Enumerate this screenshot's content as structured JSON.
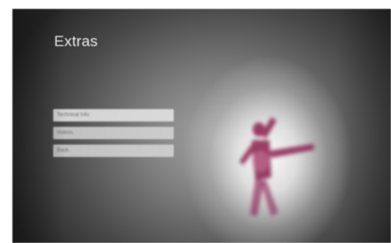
{
  "screen": {
    "title": "Extras",
    "menu": {
      "items": [
        {
          "label": "Technical Info"
        },
        {
          "label": "Videos"
        },
        {
          "label": "Back"
        }
      ]
    }
  },
  "colors": {
    "background_dark": "#262626",
    "background_mid": "#7d7d7d",
    "glow": "#f2f2f2",
    "menu_item_bg": "#dadada",
    "menu_item_text": "#6e6e6e",
    "figure_accent": "#8f2a55"
  }
}
